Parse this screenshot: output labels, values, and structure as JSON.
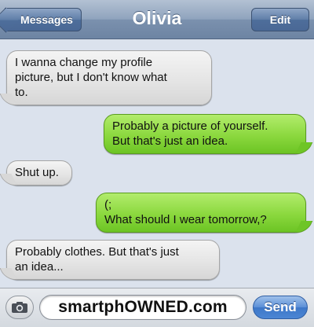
{
  "header": {
    "back_label": "Messages",
    "title": "Olivia",
    "edit_label": "Edit"
  },
  "messages": [
    {
      "side": "in",
      "text": "I wanna change my profile\npicture, but I don't know what\nto."
    },
    {
      "side": "out",
      "text": "Probably a picture of yourself.\nBut that's just an idea."
    },
    {
      "side": "in",
      "text": "Shut up."
    },
    {
      "side": "out",
      "text": "(;\nWhat should I wear tomorrow,?"
    },
    {
      "side": "in",
      "text": "Probably clothes. But that's just\nan idea..."
    }
  ],
  "composer": {
    "field_text": "smartphOWNED.com",
    "send_label": "Send",
    "camera_icon": "camera-icon"
  },
  "colors": {
    "incoming_bubble": "#e5e5e5",
    "outgoing_bubble": "#8bd83e",
    "nav_bar": "#8fa3bd",
    "send_button": "#4c86d4",
    "background": "#dbe2ed"
  }
}
